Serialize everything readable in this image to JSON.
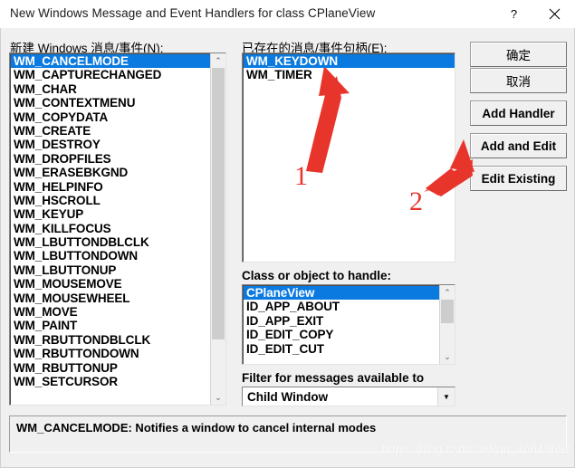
{
  "window": {
    "title": "New Windows Message and Event Handlers for class CPlaneView",
    "help_label": "?",
    "close_label": "✕"
  },
  "new_messages": {
    "label": "新建 Windows 消息/事件(N):",
    "selected": "WM_CANCELMODE",
    "items": [
      "WM_CANCELMODE",
      "WM_CAPTURECHANGED",
      "WM_CHAR",
      "WM_CONTEXTMENU",
      "WM_COPYDATA",
      "WM_CREATE",
      "WM_DESTROY",
      "WM_DROPFILES",
      "WM_ERASEBKGND",
      "WM_HELPINFO",
      "WM_HSCROLL",
      "WM_KEYUP",
      "WM_KILLFOCUS",
      "WM_LBUTTONDBLCLK",
      "WM_LBUTTONDOWN",
      "WM_LBUTTONUP",
      "WM_MOUSEMOVE",
      "WM_MOUSEWHEEL",
      "WM_MOVE",
      "WM_PAINT",
      "WM_RBUTTONDBLCLK",
      "WM_RBUTTONDOWN",
      "WM_RBUTTONUP",
      "WM_SETCURSOR"
    ]
  },
  "existing_handlers": {
    "label": "已存在的消息/事件句柄(E):",
    "selected": "WM_KEYDOWN",
    "items": [
      "WM_KEYDOWN",
      "WM_TIMER"
    ]
  },
  "class_list": {
    "label": "Class or object to handle:",
    "selected": "CPlaneView",
    "items": [
      "CPlaneView",
      "ID_APP_ABOUT",
      "ID_APP_EXIT",
      "ID_EDIT_COPY",
      "ID_EDIT_CUT"
    ]
  },
  "filter": {
    "label": "Filter for messages available to",
    "value": "Child Window",
    "arrow": "▼"
  },
  "buttons": [
    {
      "id": "ok",
      "label": "确定",
      "cjk": true
    },
    {
      "id": "cancel",
      "label": "取消",
      "cjk": true
    },
    {
      "id": "add-handler",
      "label": "Add Handler",
      "cjk": false
    },
    {
      "id": "add-and-edit",
      "label": "Add and Edit",
      "cjk": false
    },
    {
      "id": "edit-existing",
      "label": "Edit Existing",
      "cjk": false
    }
  ],
  "description": {
    "text": "WM_CANCELMODE:  Notifies a window to cancel internal modes"
  },
  "annotations": {
    "marker_one": "1",
    "marker_two": "2",
    "color": "#e8352b"
  },
  "watermark": {
    "text": "https://blog.csdn.net/qq_46649692"
  },
  "scroll": {
    "up_glyph": "⌃",
    "down_glyph": "⌄"
  }
}
